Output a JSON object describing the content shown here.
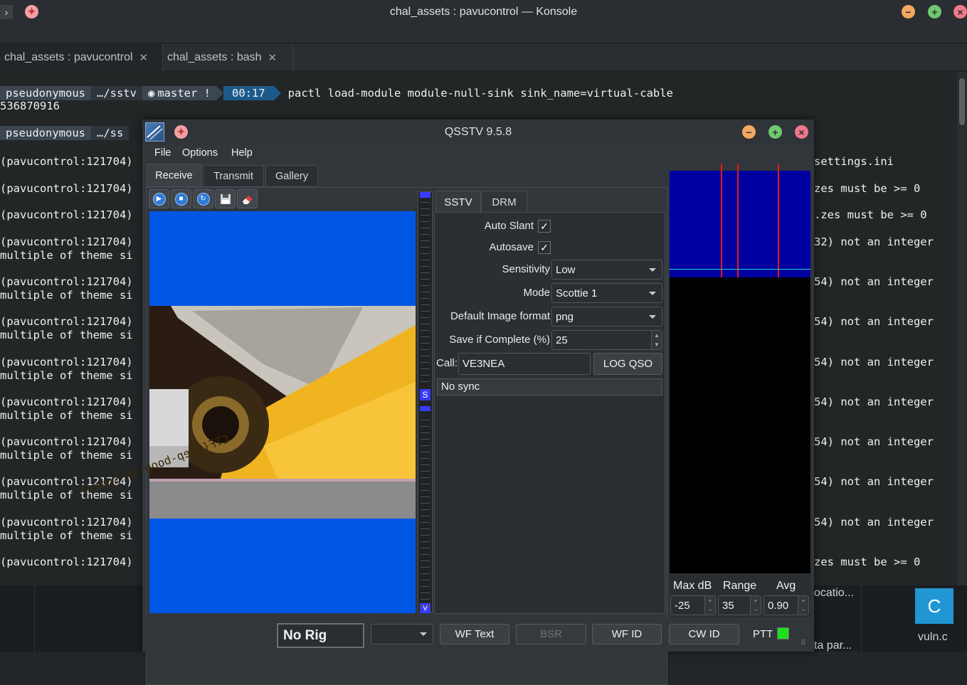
{
  "konsole": {
    "title": "chal_assets : pavucontrol — Konsole",
    "tabs": [
      {
        "label": "chal_assets : pavucontrol"
      },
      {
        "label": "chal_assets : bash"
      }
    ],
    "prompt1": {
      "user": "pseudonymous",
      "path": "…/sstv",
      "branch": "master !",
      "time": "00:17",
      "command": "pactl load-module module-null-sink sink_name=virtual-cable"
    },
    "output1": "536870916",
    "prompt2": {
      "user": "pseudonymous",
      "path": "…/ss"
    },
    "left_lines": [
      "(pavucontrol:121704)",
      "(pavucontrol:121704)",
      "(pavucontrol:121704)",
      "(pavucontrol:121704)",
      "multiple of theme si",
      "(pavucontrol:121704)",
      "multiple of theme si",
      "(pavucontrol:121704)",
      "multiple of theme si",
      "(pavucontrol:121704)",
      "multiple of theme si",
      "(pavucontrol:121704)",
      "multiple of theme si",
      "(pavucontrol:121704)",
      "multiple of theme si",
      "(pavucontrol:121704)",
      "multiple of theme si",
      "(pavucontrol:121704)",
      "multiple of theme si",
      "(pavucontrol:121704)"
    ],
    "right_lines": [
      "settings.ini",
      "zes must be >= 0",
      ".zes must be >= 0",
      "32) not an integer",
      "54) not an integer",
      "54) not an integer",
      "54) not an integer",
      "54) not an integer",
      "54) not an integer",
      "54) not an integer",
      "54) not an integer",
      "zes must be >= 0"
    ],
    "bottom": {
      "location_text": "ocatio...",
      "param_text": "ta par...",
      "file_name": "vuln.c"
    }
  },
  "qsstv": {
    "title": "QSSTV 9.5.8",
    "menu": [
      "File",
      "Options",
      "Help"
    ],
    "tabs": [
      "Receive",
      "Transmit",
      "Gallery"
    ],
    "image_text": "CTF{beep-boop-im-space}",
    "meter_label": "S",
    "meter_bottom": "V",
    "mode_tabs": [
      "SSTV",
      "DRM"
    ],
    "settings": {
      "auto_slant_label": "Auto Slant",
      "autosave_label": "Autosave",
      "check_mark": "✓",
      "sensitivity_label": "Sensitivity",
      "sensitivity_value": "Low",
      "mode_label": "Mode",
      "mode_value": "Scottie 1",
      "format_label": "Default Image format",
      "format_value": "png",
      "save_label": "Save if Complete (%)",
      "save_value": "25",
      "call_label": "Call:",
      "call_value": "VE3NEA",
      "log_button": "LOG QSO",
      "sync_status": "No sync"
    },
    "waterfall": {
      "maxdb_label": "Max dB",
      "range_label": "Range",
      "avg_label": "Avg",
      "maxdb_value": "-25",
      "range_value": "35",
      "avg_value": "0.90"
    },
    "statusbar": {
      "rig": "No Rig",
      "wf_text": "WF Text",
      "bsr": "BSR",
      "wf_id": "WF ID",
      "cw_id": "CW ID",
      "ptt": "PTT"
    },
    "colors": {
      "image_blue": "#0057e5",
      "waterfall_blue": "#0000a0",
      "ptt_green": "#1fe01f"
    }
  }
}
